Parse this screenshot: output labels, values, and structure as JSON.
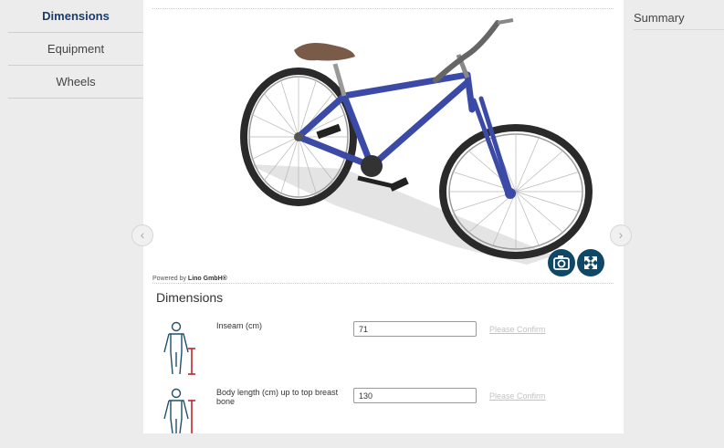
{
  "sidebar": {
    "items": [
      {
        "label": "Dimensions",
        "active": true
      },
      {
        "label": "Equipment",
        "active": false
      },
      {
        "label": "Wheels",
        "active": false
      }
    ]
  },
  "summary": {
    "title": "Summary"
  },
  "viewer": {
    "powered_prefix": "Powered by ",
    "powered_brand": "Lino GmbH®",
    "prev_icon": "chevron-left-icon",
    "next_icon": "chevron-right-icon",
    "camera_icon": "camera-icon",
    "fullscreen_icon": "fullscreen-icon",
    "bike_frame_color": "#3b4aa6"
  },
  "dimensions": {
    "title": "Dimensions",
    "fields": [
      {
        "label": "Inseam (cm)",
        "value": "71",
        "confirm": "Please Confirm"
      },
      {
        "label": "Body length (cm) up to top breast bone",
        "value": "130",
        "confirm": "Please Confirm"
      }
    ]
  },
  "colors": {
    "accent": "#1d3b6a",
    "button": "#0f4866",
    "measure": "#c0242b"
  }
}
